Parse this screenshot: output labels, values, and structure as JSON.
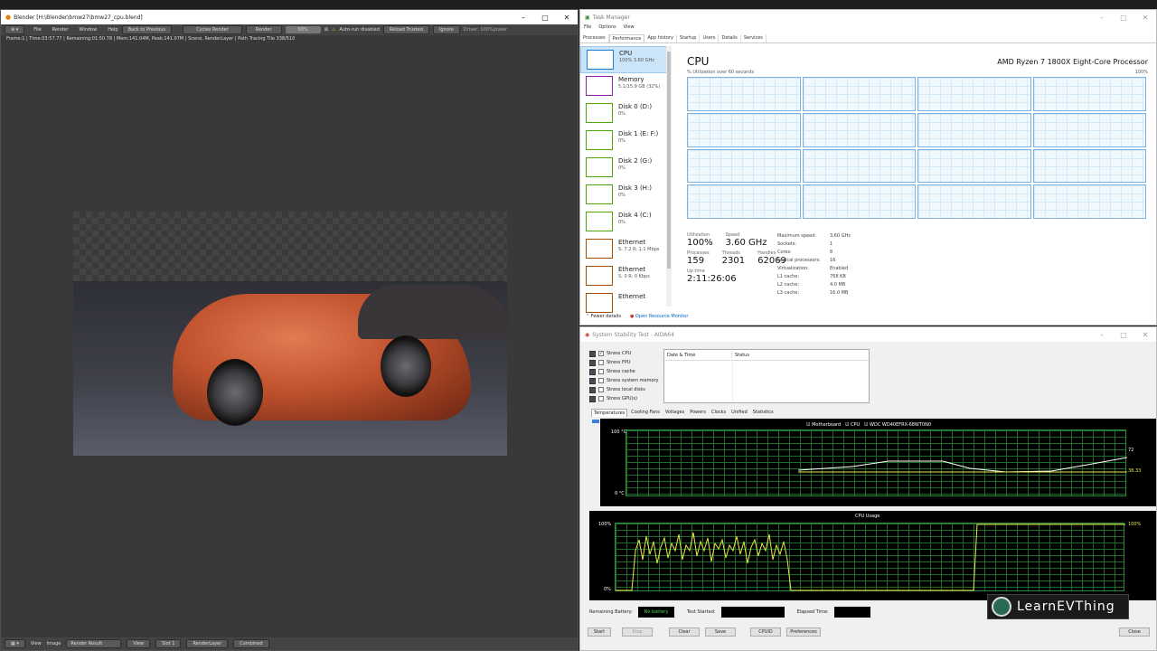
{
  "blender": {
    "title": "Blender [H:\\Blender\\bmw27\\bmw27_cpu.blend]",
    "menu": [
      "File",
      "Render",
      "Window",
      "Help"
    ],
    "back_btn": "Back to Previous",
    "engine": "Cycles Render",
    "render_btn": "Render",
    "progress": "68%",
    "warn": "Auto-run disabled",
    "reload": "Reload Trusted",
    "ignore": "Ignore",
    "driver": "Driver: 100%power",
    "info": "Frame:1 | Time:03:57.77 | Remaining:01:50.78 | Mem:141.04M, Peak:141.07M | Scene, RenderLayer | Path Tracing Tile 338/510",
    "footer": {
      "view": "View",
      "image": "Image",
      "result": "Render Result",
      "view2": "View",
      "slot": "Slot 1",
      "layer": "RenderLayer",
      "pass": "Combined"
    }
  },
  "taskmgr": {
    "title": "Task Manager",
    "menu": [
      "File",
      "Options",
      "View"
    ],
    "tabs": [
      "Processes",
      "Performance",
      "App history",
      "Startup",
      "Users",
      "Details",
      "Services"
    ],
    "resources": [
      {
        "name": "CPU",
        "sub": "100% 3.60 GHz",
        "color": "#1b7ed4"
      },
      {
        "name": "Memory",
        "sub": "5.1/15.9 GB (32%)",
        "color": "#8b1fae"
      },
      {
        "name": "Disk 0 (D:)",
        "sub": "0%",
        "color": "#4da60c"
      },
      {
        "name": "Disk 1 (E: F:)",
        "sub": "0%",
        "color": "#4da60c"
      },
      {
        "name": "Disk 2 (G:)",
        "sub": "0%",
        "color": "#4da60c"
      },
      {
        "name": "Disk 3 (H:)",
        "sub": "0%",
        "color": "#4da60c"
      },
      {
        "name": "Disk 4 (C:)",
        "sub": "0%",
        "color": "#4da60c"
      },
      {
        "name": "Ethernet",
        "sub": "S: 7.2 R: 1.1 Mbps",
        "color": "#a74f01"
      },
      {
        "name": "Ethernet",
        "sub": "S: 0 R: 0 Kbps",
        "color": "#a74f01"
      },
      {
        "name": "Ethernet",
        "sub": "",
        "color": "#a74f01"
      }
    ],
    "cpu_title": "CPU",
    "cpu_name": "AMD Ryzen 7 1800X Eight-Core Processor",
    "util_label": "% Utilization over 60 seconds",
    "util_max": "100%",
    "stats": {
      "util_lbl": "Utilization",
      "util_val": "100%",
      "speed_lbl": "Speed",
      "speed_val": "3.60 GHz",
      "proc_lbl": "Processes",
      "proc_val": "159",
      "thr_lbl": "Threads",
      "thr_val": "2301",
      "hnd_lbl": "Handles",
      "hnd_val": "62069",
      "up_lbl": "Up time",
      "up_val": "2:11:26:06"
    },
    "specs": [
      [
        "Maximum speed:",
        "3.60 GHz"
      ],
      [
        "Sockets:",
        "1"
      ],
      [
        "Cores:",
        "8"
      ],
      [
        "Logical processors:",
        "16"
      ],
      [
        "Virtualization:",
        "Enabled"
      ],
      [
        "L1 cache:",
        "768 KB"
      ],
      [
        "L2 cache:",
        "4.0 MB"
      ],
      [
        "L3 cache:",
        "16.0 MB"
      ]
    ],
    "fewer": "Fewer details",
    "monitor": "Open Resource Monitor"
  },
  "aida": {
    "title": "System Stability Test - AIDA64",
    "checks": [
      {
        "label": "Stress CPU",
        "checked": true
      },
      {
        "label": "Stress FPU",
        "checked": false
      },
      {
        "label": "Stress cache",
        "checked": false
      },
      {
        "label": "Stress system memory",
        "checked": false
      },
      {
        "label": "Stress local disks",
        "checked": false
      },
      {
        "label": "Stress GPU(s)",
        "checked": false
      }
    ],
    "col_dt": "Date & Time",
    "col_status": "Status",
    "tabs": [
      "Temperatures",
      "Cooling Fans",
      "Voltages",
      "Powers",
      "Clocks",
      "Unified",
      "Statistics"
    ],
    "legend": [
      "Motherboard",
      "CPU",
      "WDC WD40EFRX-68WT0N0"
    ],
    "temp_top": "100 °C",
    "temp_bot": "0 °C",
    "temp_r1": "72",
    "temp_r2": "38.33",
    "usage_title": "CPU Usage",
    "usage_top": "100%",
    "usage_bot": "0%",
    "usage_right": "100%",
    "battery_lbl": "Remaining Battery:",
    "battery_val": "No battery",
    "started_lbl": "Test Started:",
    "elapsed_lbl": "Elapsed Time:",
    "buttons": [
      "Start",
      "Stop",
      "Clear",
      "Save",
      "CPUID",
      "Preferences",
      "Close"
    ]
  },
  "watermark": "LearnEVThing"
}
